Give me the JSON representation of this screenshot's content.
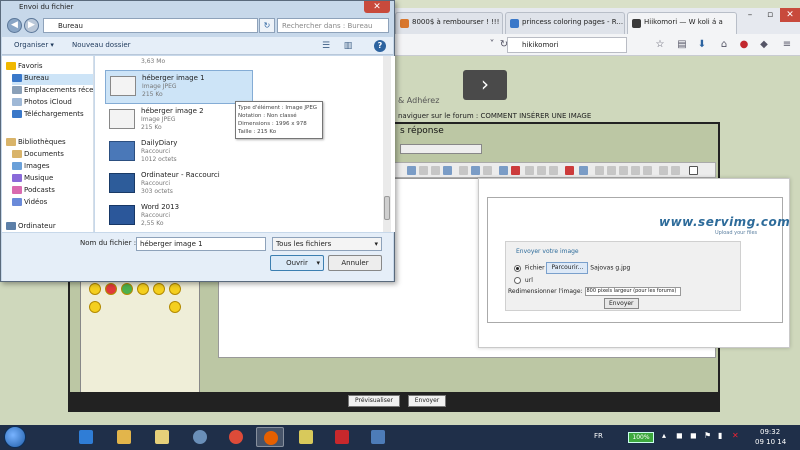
{
  "browser": {
    "tabs": [
      {
        "label": "8000$ à rembourser ! !!!",
        "color": "#d8762c"
      },
      {
        "label": "princess coloring pages - R...",
        "color": "#3a78c9"
      },
      {
        "label": "Hiikomori — W koli á a",
        "color": "#3a3a3a"
      }
    ],
    "url": "hikikomori",
    "next_arrow": "›",
    "page_text_1": "& Adhérez",
    "page_text_2": "naviguer sur le forum : COMMENT INSÉRER UNE IMAGE",
    "reply_heading": "s réponse",
    "preview_btn": "Prévisualiser",
    "send_btn": "Envoyer"
  },
  "upload": {
    "logo": "www.servimg.com",
    "logo_sub": "Upload your files",
    "title": "Envoyer votre image",
    "file_label": "Fichier",
    "browse_btn": "Parcourir...",
    "filename": "Sajovas g.jpg",
    "url_label": "url",
    "resize_label": "Redimensionner l'image:",
    "resize_value": "800 pixels largeur (pour les forums)",
    "send_label": "Envoyer"
  },
  "dialog": {
    "title": "Envoi du fichier",
    "close": "✕",
    "path": "Bureau",
    "search_placeholder": "Rechercher dans : Bureau",
    "organize": "Organiser ▾",
    "new_folder": "Nouveau dossier",
    "nav": {
      "favorites": "Favoris",
      "desktop": "Bureau",
      "recent": "Emplacements récents",
      "photos": "Photos iCloud",
      "downloads": "Téléchargements",
      "libraries": "Bibliothèques",
      "documents": "Documents",
      "images": "Images",
      "music": "Musique",
      "podcasts": "Podcasts",
      "videos": "Vidéos",
      "computer": "Ordinateur"
    },
    "files": [
      {
        "name": "",
        "type": "",
        "size": "3,63 Mo"
      },
      {
        "name": "héberger image 1",
        "type": "Image JPEG",
        "size": "215 Ko"
      },
      {
        "name": "héberger image 2",
        "type": "Image JPEG",
        "size": "215 Ko"
      },
      {
        "name": "DailyDiary",
        "type": "Raccourci",
        "size": "1012 octets"
      },
      {
        "name": "Ordinateur - Raccourci",
        "type": "Raccourci",
        "size": "303 octets"
      },
      {
        "name": "Word 2013",
        "type": "Raccourci",
        "size": "2,55 Ko"
      }
    ],
    "tooltip": {
      "line1": "Type d'élément : Image JPEG",
      "line2": "Notation : Non classé",
      "line3": "Dimensions : 1996 x 978",
      "line4": "Taille : 215 Ko"
    },
    "filename_label": "Nom du fichier :",
    "filename_value": "héberger image 1",
    "filetype": "Tous les fichiers",
    "open_btn": "Ouvrir",
    "cancel_btn": "Annuler"
  },
  "taskbar": {
    "lang": "FR",
    "battery": "100%",
    "time": "09:32",
    "date": "09 10 14"
  }
}
